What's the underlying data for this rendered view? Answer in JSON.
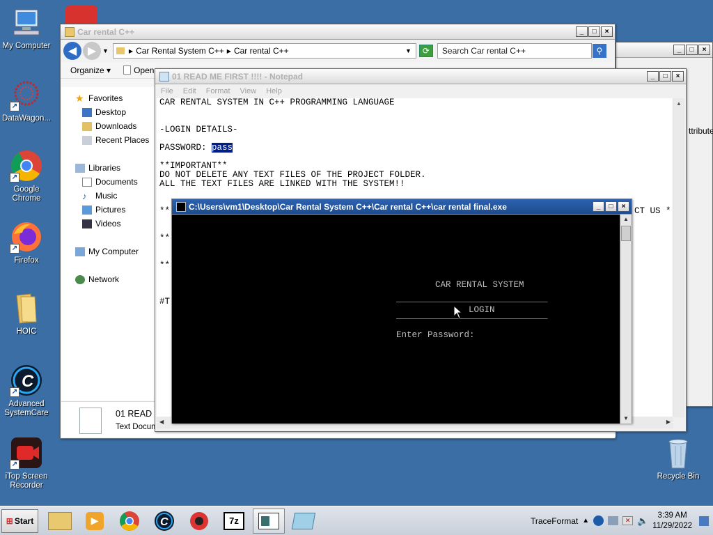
{
  "desktop": {
    "icons": [
      {
        "label": "My Computer"
      },
      {
        "label": "DataWagon..."
      },
      {
        "label": "Google Chrome"
      },
      {
        "label": "Firefox"
      },
      {
        "label": "HOIC"
      },
      {
        "label": "Advanced SystemCare"
      },
      {
        "label": "iTop Screen Recorder"
      },
      {
        "label": "Recycle Bin"
      }
    ]
  },
  "explorer": {
    "title": "Car rental C++",
    "breadcrumb": [
      "Car Rental System C++",
      "Car rental C++"
    ],
    "search_placeholder": "Search Car rental C++",
    "organize_label": "Organize",
    "open_label": "Open",
    "nav": {
      "favorites": "Favorites",
      "desktop": "Desktop",
      "downloads": "Downloads",
      "recent": "Recent Places",
      "libraries": "Libraries",
      "documents": "Documents",
      "music": "Music",
      "pictures": "Pictures",
      "videos": "Videos",
      "computer": "My Computer",
      "network": "Network"
    },
    "details": {
      "name": "01 READ M",
      "type": "Text Docum"
    }
  },
  "bgwin": {
    "label": "ttributes"
  },
  "notepad": {
    "title": "01 READ ME FIRST !!!! - Notepad",
    "menu": [
      "File",
      "Edit",
      "Format",
      "View",
      "Help"
    ],
    "lines": {
      "l1": "CAR RENTAL SYSTEM IN C++ PROGRAMMING LANGUAGE",
      "l2": "-LOGIN DETAILS-",
      "l3_prefix": "PASSWORD: ",
      "l3_selected": "pass",
      "l4": "**IMPORTANT**",
      "l5": "DO NOT DELETE ANY TEXT FILES OF THE PROJECT FOLDER.",
      "l6": "ALL THE TEXT FILES ARE LINKED WITH THE SYSTEM!!",
      "l7a": "**",
      "l7b": "CT US *",
      "l8": "**",
      "l9": "**",
      "l10": "#T"
    }
  },
  "console": {
    "title": "C:\\Users\\vm1\\Desktop\\Car Rental System C++\\Car rental C++\\car rental final.exe",
    "heading": "CAR RENTAL SYSTEM",
    "rule": "_____________________________",
    "login": "LOGIN",
    "prompt": "Enter Password:"
  },
  "taskbar": {
    "start_label": "Start",
    "tray_text": "TraceFormat",
    "time": "3:39 AM",
    "date": "11/29/2022"
  }
}
